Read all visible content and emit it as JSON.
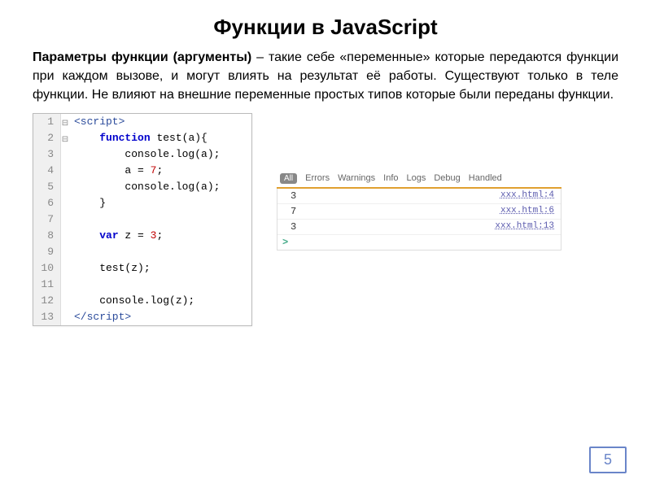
{
  "title": "Функции в JavaScript",
  "paragraph": {
    "lead_bold": "Параметры функции (аргументы)",
    "rest": " – такие себе «переменные» которые передаются функции при каждом вызове, и могут влиять на результат её работы. Существуют только в теле функции. Не влияют на внешние переменные простых типов которые были переданы функции."
  },
  "code": {
    "lines": [
      {
        "n": "1",
        "fold": "⊟",
        "segs": [
          {
            "t": "<script>",
            "c": "tag"
          }
        ]
      },
      {
        "n": "2",
        "fold": "⊟",
        "segs": [
          {
            "t": "    ",
            "c": "plain"
          },
          {
            "t": "function",
            "c": "keyword"
          },
          {
            "t": " test(a){",
            "c": "funcname"
          }
        ]
      },
      {
        "n": "3",
        "fold": "",
        "segs": [
          {
            "t": "        console.log(a);",
            "c": "plain"
          }
        ]
      },
      {
        "n": "4",
        "fold": "",
        "segs": [
          {
            "t": "        a = ",
            "c": "plain"
          },
          {
            "t": "7",
            "c": "number"
          },
          {
            "t": ";",
            "c": "plain"
          }
        ]
      },
      {
        "n": "5",
        "fold": "",
        "segs": [
          {
            "t": "        console.log(a);",
            "c": "plain"
          }
        ]
      },
      {
        "n": "6",
        "fold": "",
        "segs": [
          {
            "t": "    }",
            "c": "plain"
          }
        ]
      },
      {
        "n": "7",
        "fold": "",
        "segs": [
          {
            "t": "",
            "c": "plain"
          }
        ]
      },
      {
        "n": "8",
        "fold": "",
        "segs": [
          {
            "t": "    ",
            "c": "plain"
          },
          {
            "t": "var",
            "c": "keyword"
          },
          {
            "t": " z = ",
            "c": "plain"
          },
          {
            "t": "3",
            "c": "number"
          },
          {
            "t": ";",
            "c": "plain"
          }
        ]
      },
      {
        "n": "9",
        "fold": "",
        "segs": [
          {
            "t": "",
            "c": "plain"
          }
        ]
      },
      {
        "n": "10",
        "fold": "",
        "segs": [
          {
            "t": "    test(z);",
            "c": "plain"
          }
        ]
      },
      {
        "n": "11",
        "fold": "",
        "segs": [
          {
            "t": "",
            "c": "plain"
          }
        ]
      },
      {
        "n": "12",
        "fold": "",
        "segs": [
          {
            "t": "    console.log(z);",
            "c": "plain"
          }
        ]
      },
      {
        "n": "13",
        "fold": "",
        "segs": [
          {
            "t": "</script>",
            "c": "tag"
          }
        ]
      }
    ]
  },
  "console": {
    "tabs": {
      "all": "All",
      "items": [
        "Errors",
        "Warnings",
        "Info",
        "Logs",
        "Debug",
        "Handled"
      ]
    },
    "logs": [
      {
        "val": "3",
        "src": "xxx.html:4"
      },
      {
        "val": "7",
        "src": "xxx.html:6"
      },
      {
        "val": "3",
        "src": "xxx.html:13"
      }
    ],
    "prompt": ">"
  },
  "page_number": "5"
}
